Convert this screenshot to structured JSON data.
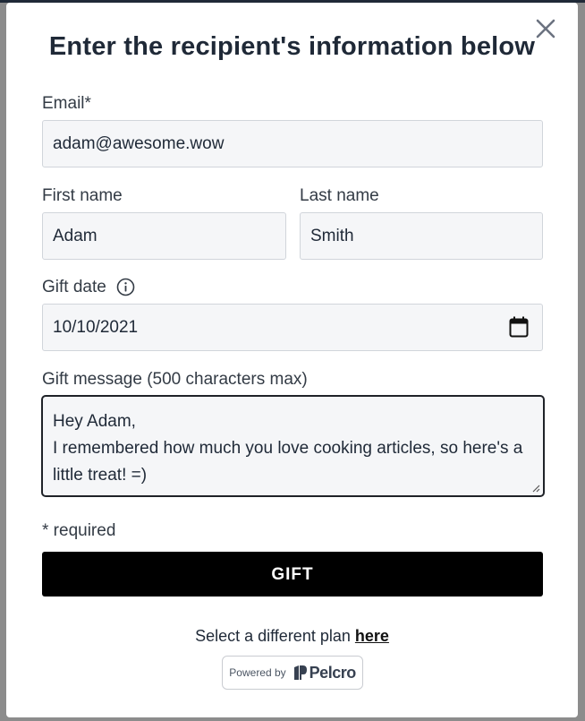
{
  "modal": {
    "title": "Enter the recipient's information below",
    "close_icon": "close-icon"
  },
  "form": {
    "email": {
      "label": "Email*",
      "value": "adam@awesome.wow"
    },
    "first_name": {
      "label": "First name",
      "value": "Adam"
    },
    "last_name": {
      "label": "Last name",
      "value": "Smith"
    },
    "gift_date": {
      "label": "Gift date",
      "value": "10/10/2021",
      "info_icon": "info-icon",
      "calendar_icon": "calendar-icon"
    },
    "gift_message": {
      "label": "Gift message (500 characters max)",
      "value": "Hey Adam,\nI remembered how much you love cooking articles, so here's a little treat! =)"
    },
    "required_note": "* required",
    "submit_label": "GIFT"
  },
  "footer": {
    "plan_text": "Select a different plan",
    "plan_link": "here",
    "powered_by": "Powered by",
    "brand": "Pelcro"
  },
  "colors": {
    "button_bg": "#000000",
    "field_bg": "#f5f6f8",
    "text": "#1f2937"
  }
}
